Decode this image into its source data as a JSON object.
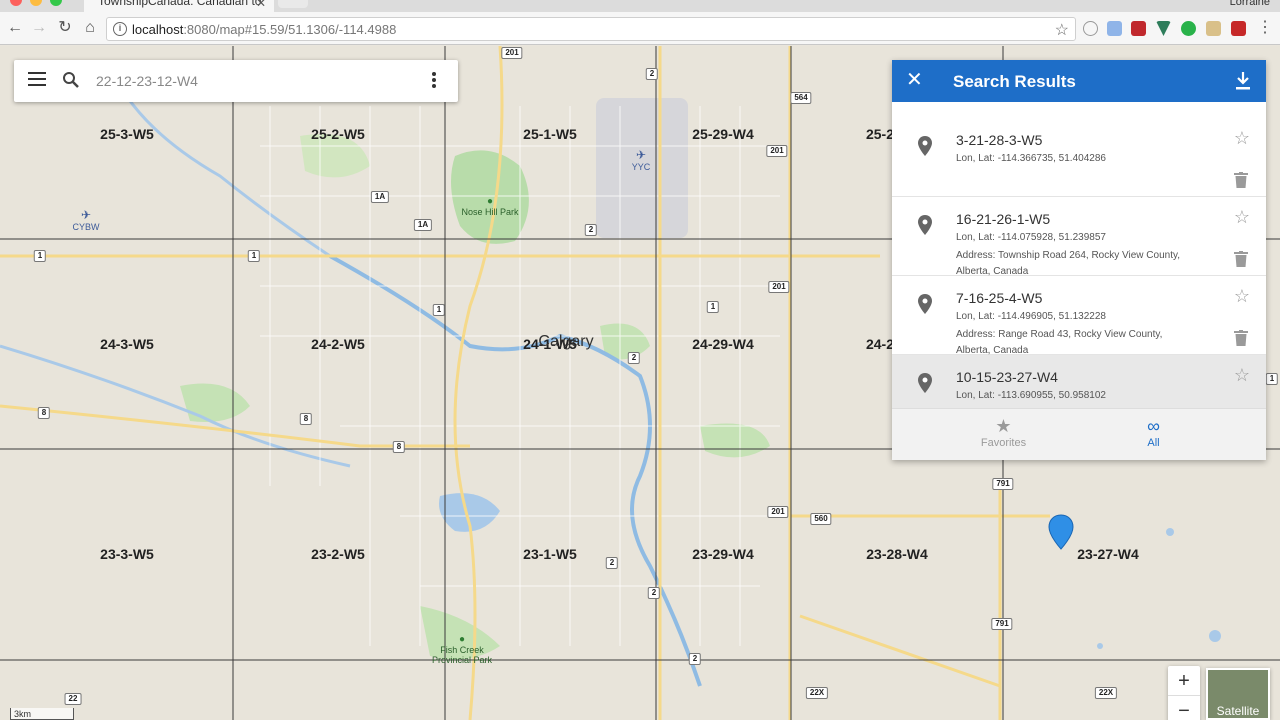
{
  "browser": {
    "tab_title": "TownshipCanada: Canadian to",
    "profile": "Lorraine",
    "url_host": "localhost",
    "url_path": ":8080/map#15.59/51.1306/-114.4988"
  },
  "search": {
    "query": "22-12-23-12-W4"
  },
  "panel": {
    "title": "Search Results",
    "results": [
      {
        "name": "3-21-28-3-W5",
        "coords": "Lon, Lat: -114.366735, 51.404286",
        "address": ""
      },
      {
        "name": "16-21-26-1-W5",
        "coords": "Lon, Lat: -114.075928, 51.239857",
        "address": "Address: Township Road 264, Rocky View County, Alberta, Canada"
      },
      {
        "name": "7-16-25-4-W5",
        "coords": "Lon, Lat: -114.496905, 51.132228",
        "address": "Address: Range Road 43, Rocky View County, Alberta, Canada"
      },
      {
        "name": "10-15-23-27-W4",
        "coords": "Lon, Lat: -113.690955, 50.958102",
        "address": ""
      }
    ],
    "tabs": {
      "favorites": "Favorites",
      "all": "All"
    }
  },
  "map": {
    "townships": [
      "25-3-W5",
      "25-2-W5",
      "25-1-W5",
      "25-29-W4",
      "25-2",
      "24-3-W5",
      "24-2-W5",
      "24-1-W5",
      "24-29-W4",
      "24-2",
      "23-3-W5",
      "23-2-W5",
      "23-1-W5",
      "23-29-W4",
      "23-28-W4",
      "23-27-W4"
    ],
    "city": "Calgary",
    "places": {
      "nose_hill": "Nose Hill Park",
      "fish_creek": "Fish Creek Provincial Park",
      "yyc": "YYC",
      "cybw": "CYBW"
    },
    "shields": [
      "201",
      "2",
      "564",
      "201",
      "1A",
      "1A",
      "2",
      "201",
      "1",
      "1",
      "1",
      "1",
      "2",
      "8",
      "8",
      "8",
      "201",
      "560",
      "791",
      "2",
      "2",
      "791",
      "2",
      "22",
      "22X",
      "22X",
      "1"
    ],
    "scale": "3km"
  },
  "controls": {
    "zoom_in": "+",
    "zoom_out": "−",
    "satellite": "Satellite"
  },
  "colors": {
    "accent": "#1e6ec8",
    "marker": "#2f8fe6"
  }
}
